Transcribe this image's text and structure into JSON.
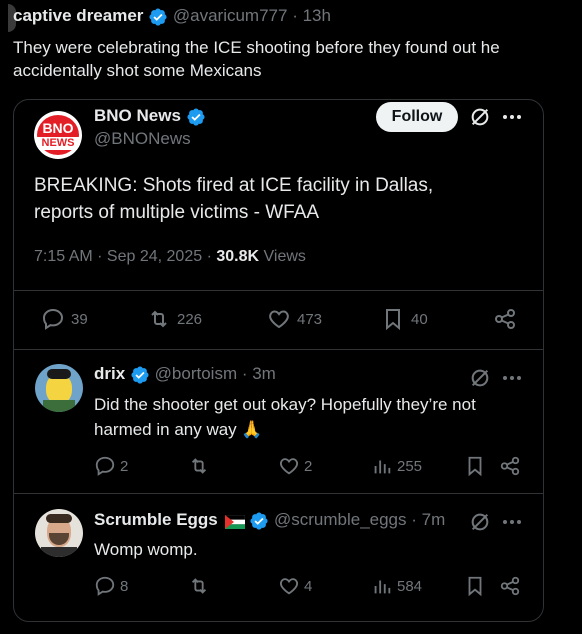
{
  "outer": {
    "author_name": "captive dreamer",
    "handle": "@avaricum777",
    "time": "· 13h",
    "text_line1": "They were celebrating the ICE shooting before they found out he",
    "text_line2": "accidentally shot some Mexicans"
  },
  "quoted": {
    "logo_top": "BNO",
    "logo_bottom": "NEWS",
    "author_name": "BNO News",
    "handle": "@BNONews",
    "follow_label": "Follow",
    "text_line1": "BREAKING: Shots fired at ICE facility in Dallas,",
    "text_line2": "reports of multiple victims - WFAA",
    "meta_time": "7:15 AM · Sep 24, 2025 ·",
    "views_count": "30.8K",
    "views_label": "Views",
    "replies": "39",
    "reposts": "226",
    "likes": "473",
    "bookmarks": "40"
  },
  "replies": [
    {
      "author_name": "drix",
      "handle": "@bortoism",
      "time": "· 3m",
      "text_line1": "Did the shooter get out okay? Hopefully they’re not",
      "text_line2": "harmed in any way 🙏",
      "replies": "2",
      "likes": "2",
      "views": "255"
    },
    {
      "author_name": "Scrumble Eggs",
      "handle": "@scrumble_eggs",
      "time": "· 7m",
      "text_line1": "Womp womp.",
      "replies": "8",
      "likes": "4",
      "views": "584"
    }
  ],
  "colors": {
    "background": "#000000",
    "text": "#e7e9ea",
    "secondary": "#71767b",
    "verified": "#1d9bf0",
    "border": "#2f3336",
    "bno_red": "#e31e26"
  }
}
